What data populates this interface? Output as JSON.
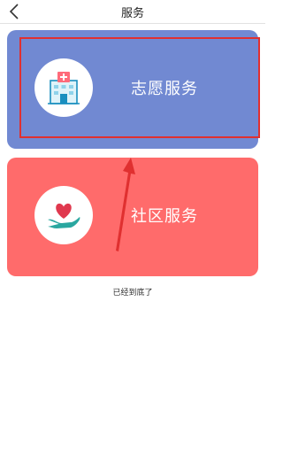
{
  "header": {
    "title": "服务"
  },
  "cards": [
    {
      "label": "志愿服务",
      "icon": "hospital-building-icon",
      "color": "#7189d2"
    },
    {
      "label": "社区服务",
      "icon": "heart-in-hand-icon",
      "color": "#ff6b6b"
    }
  ],
  "footer": {
    "end_text": "已经到底了"
  },
  "annotation": {
    "highlight_color": "#e03030"
  }
}
